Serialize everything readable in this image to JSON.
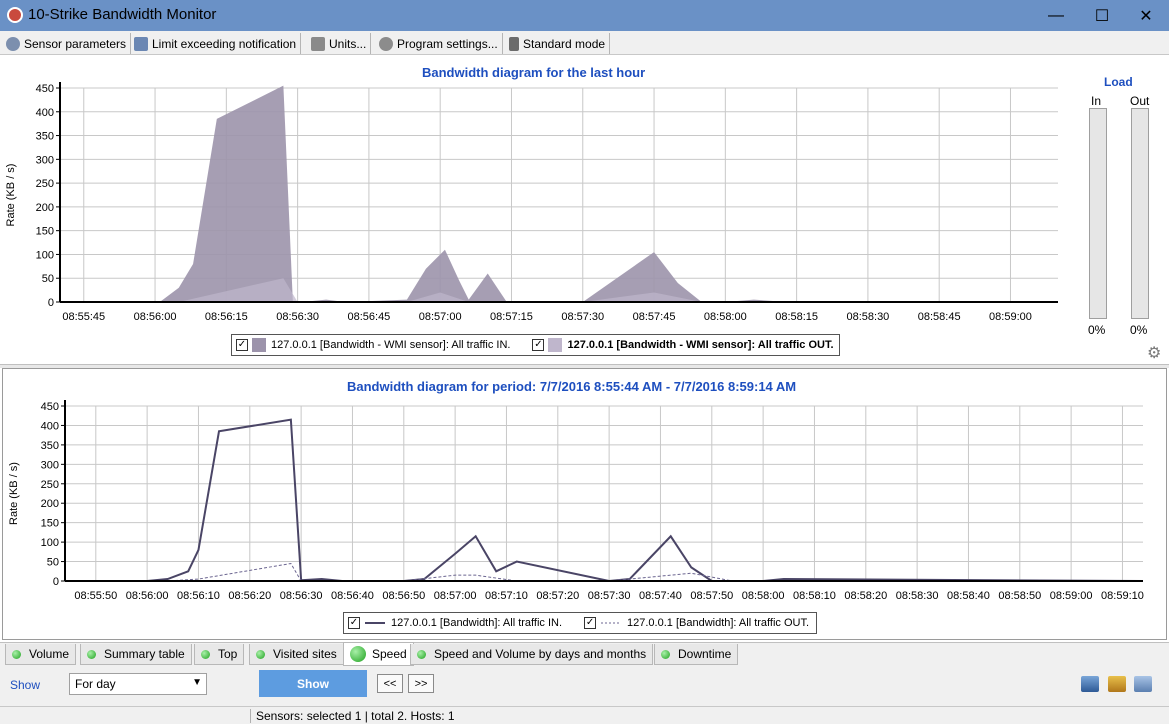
{
  "window": {
    "title": "10-Strike Bandwidth Monitor"
  },
  "toolbar": {
    "sensor_parameters": "Sensor parameters",
    "limit_notification": "Limit exceeding notification",
    "units": "Units...",
    "program_settings": "Program settings...",
    "standard_mode": "Standard mode"
  },
  "colors": {
    "accent_title": "#1e4fbf",
    "area_in": "#9c93ab",
    "area_out": "#bfb6cc",
    "line": "#4a4566",
    "show_button": "#5d9ce0",
    "titlebar": "#6a91c6"
  },
  "top_chart": {
    "title": "Bandwidth diagram for the last hour",
    "ylabel": "Rate (KB / s)",
    "legend": {
      "in_label": "127.0.0.1 [Bandwidth - WMI sensor]: All traffic IN.",
      "out_label": "127.0.0.1 [Bandwidth - WMI sensor]: All traffic OUT."
    }
  },
  "bottom_chart": {
    "title": "Bandwidth diagram for period: 7/7/2016 8:55:44 AM - 7/7/2016 8:59:14 AM",
    "ylabel": "Rate (KB / s)",
    "legend": {
      "in_label": "127.0.0.1 [Bandwidth]: All traffic IN.",
      "out_label": "127.0.0.1 [Bandwidth]: All traffic OUT."
    }
  },
  "load": {
    "title": "Load",
    "in_label": "In",
    "out_label": "Out",
    "in_value": "0%",
    "out_value": "0%"
  },
  "tabs": [
    "Volume",
    "Summary table",
    "Top",
    "Visited sites",
    "Speed",
    "Speed and Volume by days and months",
    "Downtime"
  ],
  "active_tab": "Speed",
  "controls": {
    "show_label": "Show",
    "period_select": "For day",
    "show_button": "Show",
    "prev": "<<",
    "next": ">>"
  },
  "status": {
    "text": "Sensors: selected 1 | total 2. Hosts: 1"
  },
  "chart_data": [
    {
      "type": "area",
      "title": "Bandwidth diagram for the last hour",
      "ylabel": "Rate (KB / s)",
      "ylim": [
        0,
        450
      ],
      "xlim": [
        "08:55:40",
        "08:59:10"
      ],
      "x_ticks": [
        "08:55:45",
        "08:56:00",
        "08:56:15",
        "08:56:30",
        "08:56:45",
        "08:57:00",
        "08:57:15",
        "08:57:30",
        "08:57:45",
        "08:58:00",
        "08:58:15",
        "08:58:30",
        "08:58:45",
        "08:59:00"
      ],
      "y_ticks": [
        0,
        50,
        100,
        150,
        200,
        250,
        300,
        350,
        400,
        450
      ],
      "grid": true,
      "series": [
        {
          "name": "127.0.0.1 [Bandwidth - WMI sensor]: All traffic IN.",
          "x": [
            "08:55:40",
            "08:56:01",
            "08:56:05",
            "08:56:08",
            "08:56:13",
            "08:56:27",
            "08:56:29",
            "08:56:31",
            "08:56:36",
            "08:56:40",
            "08:56:53",
            "08:56:57",
            "08:57:01",
            "08:57:04",
            "08:57:06",
            "08:57:10",
            "08:57:14",
            "08:57:30",
            "08:57:45",
            "08:57:50",
            "08:57:55",
            "08:58:00",
            "08:58:06",
            "08:58:13",
            "08:58:30",
            "08:59:10"
          ],
          "values": [
            0,
            0,
            30,
            80,
            385,
            455,
            0,
            0,
            5,
            0,
            5,
            70,
            110,
            45,
            5,
            60,
            0,
            0,
            105,
            40,
            0,
            0,
            5,
            0,
            0,
            0
          ]
        },
        {
          "name": "127.0.0.1 [Bandwidth - WMI sensor]: All traffic OUT.",
          "x": [
            "08:55:40",
            "08:56:05",
            "08:56:27",
            "08:56:30",
            "08:56:53",
            "08:57:00",
            "08:57:06",
            "08:57:30",
            "08:57:45",
            "08:57:55",
            "08:59:10"
          ],
          "values": [
            0,
            0,
            50,
            0,
            0,
            20,
            0,
            0,
            20,
            0,
            0
          ]
        }
      ],
      "legend": "bottom"
    },
    {
      "type": "line",
      "title": "Bandwidth diagram for period: 7/7/2016 8:55:44 AM - 7/7/2016 8:59:14 AM",
      "ylabel": "Rate (KB / s)",
      "ylim": [
        0,
        450
      ],
      "xlim": [
        "08:55:44",
        "08:59:14"
      ],
      "x_ticks": [
        "08:55:50",
        "08:56:00",
        "08:56:10",
        "08:56:20",
        "08:56:30",
        "08:56:40",
        "08:56:50",
        "08:57:00",
        "08:57:10",
        "08:57:20",
        "08:57:30",
        "08:57:40",
        "08:57:50",
        "08:58:00",
        "08:58:10",
        "08:58:20",
        "08:58:30",
        "08:58:40",
        "08:58:50",
        "08:59:00",
        "08:59:10"
      ],
      "y_ticks": [
        0,
        50,
        100,
        150,
        200,
        250,
        300,
        350,
        400,
        450
      ],
      "grid": true,
      "series": [
        {
          "name": "127.0.0.1 [Bandwidth]: All traffic IN.",
          "x": [
            "08:55:44",
            "08:56:00",
            "08:56:04",
            "08:56:08",
            "08:56:10",
            "08:56:14",
            "08:56:28",
            "08:56:30",
            "08:56:34",
            "08:56:38",
            "08:56:50",
            "08:56:54",
            "08:57:00",
            "08:57:04",
            "08:57:08",
            "08:57:12",
            "08:57:30",
            "08:57:34",
            "08:57:42",
            "08:57:46",
            "08:57:50",
            "08:58:00",
            "08:58:04",
            "08:59:14"
          ],
          "values": [
            0,
            0,
            5,
            25,
            80,
            385,
            415,
            2,
            5,
            0,
            0,
            5,
            70,
            115,
            25,
            50,
            0,
            5,
            115,
            35,
            0,
            0,
            5,
            0
          ]
        },
        {
          "name": "127.0.0.1 [Bandwidth]: All traffic OUT.",
          "x": [
            "08:55:44",
            "08:56:04",
            "08:56:10",
            "08:56:28",
            "08:56:30",
            "08:56:50",
            "08:57:00",
            "08:57:04",
            "08:57:12",
            "08:57:30",
            "08:57:46",
            "08:57:54",
            "08:59:14"
          ],
          "values": [
            0,
            0,
            5,
            45,
            0,
            0,
            15,
            15,
            0,
            0,
            20,
            0,
            0
          ]
        }
      ],
      "legend": "bottom"
    }
  ]
}
